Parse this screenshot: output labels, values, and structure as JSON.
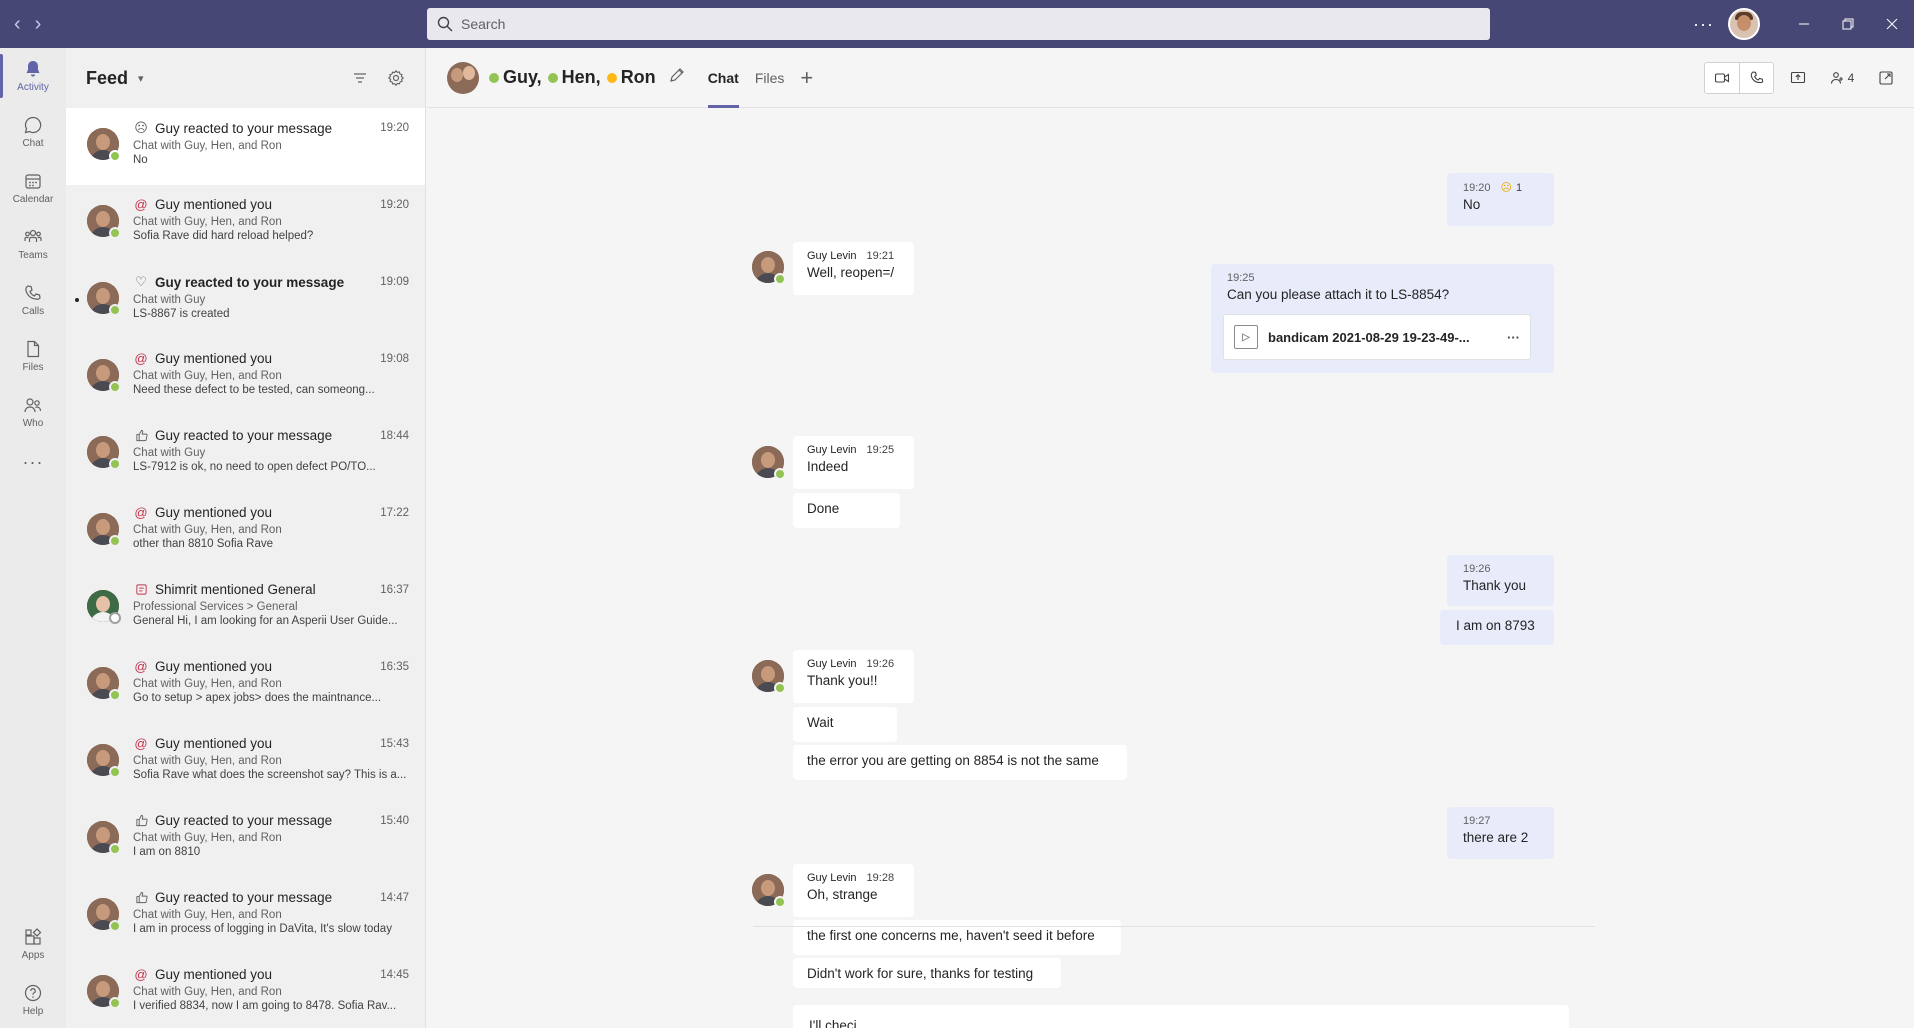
{
  "search": {
    "placeholder": "Search"
  },
  "titlebar": {
    "more": "···"
  },
  "rail": {
    "items": [
      {
        "label": "Activity",
        "icon": "bell-icon"
      },
      {
        "label": "Chat",
        "icon": "chat-icon"
      },
      {
        "label": "Calendar",
        "icon": "calendar-icon"
      },
      {
        "label": "Teams",
        "icon": "teams-icon"
      },
      {
        "label": "Calls",
        "icon": "phone-icon"
      },
      {
        "label": "Files",
        "icon": "file-icon"
      },
      {
        "label": "Who",
        "icon": "who-icon"
      }
    ],
    "more": "···",
    "bottom": [
      {
        "label": "Apps",
        "icon": "apps-icon"
      },
      {
        "label": "Help",
        "icon": "help-icon"
      }
    ]
  },
  "feed": {
    "title": "Feed",
    "items": [
      {
        "icon": "sad-emoji-icon",
        "title": "Guy reacted to your message",
        "time": "19:20",
        "sub": "Chat with Guy, Hen, and Ron",
        "preview": "No"
      },
      {
        "icon": "at-icon",
        "title": "Guy mentioned you",
        "time": "19:20",
        "sub": "Chat with Guy, Hen, and Ron",
        "preview": "Sofia Rave did hard reload helped?"
      },
      {
        "icon": "heart-icon",
        "title": "Guy reacted to your message",
        "time": "19:09",
        "sub": "Chat with Guy",
        "preview": "LS-8867 is created"
      },
      {
        "icon": "at-icon",
        "title": "Guy mentioned you",
        "time": "19:08",
        "sub": "Chat with Guy, Hen, and Ron",
        "preview": "Need these defect to be tested, can someong..."
      },
      {
        "icon": "like-icon",
        "title": "Guy reacted to your message",
        "time": "18:44",
        "sub": "Chat with Guy",
        "preview": "LS-7912 is ok, no need to open defect PO/TO..."
      },
      {
        "icon": "at-icon",
        "title": "Guy mentioned you",
        "time": "17:22",
        "sub": "Chat with Guy, Hen, and Ron",
        "preview": "other than 8810 Sofia Rave"
      },
      {
        "icon": "channel-icon",
        "title": "Shimrit mentioned General",
        "time": "16:37",
        "sub": "Professional Services > General",
        "preview": "General Hi, I am looking for an Asperii User Guide..."
      },
      {
        "icon": "at-icon",
        "title": "Guy mentioned you",
        "time": "16:35",
        "sub": "Chat with Guy, Hen, and Ron",
        "preview": "Go to setup > apex jobs> does the maintnance..."
      },
      {
        "icon": "at-icon",
        "title": "Guy mentioned you",
        "time": "15:43",
        "sub": "Chat with Guy, Hen, and Ron",
        "preview": "Sofia Rave what does the screenshot say? This is a..."
      },
      {
        "icon": "like-icon",
        "title": "Guy reacted to your message",
        "time": "15:40",
        "sub": "Chat with Guy, Hen, and Ron",
        "preview": "I am on 8810"
      },
      {
        "icon": "like-icon",
        "title": "Guy reacted to your message",
        "time": "14:47",
        "sub": "Chat with Guy, Hen, and Ron",
        "preview": "I am in process of logging in DaVita, It's slow today"
      },
      {
        "icon": "at-icon",
        "title": "Guy mentioned you",
        "time": "14:45",
        "sub": "Chat with Guy, Hen, and Ron",
        "preview": "I verified 8834, now I am going to 8478. Sofia Rav..."
      }
    ]
  },
  "chat": {
    "participants": [
      "Guy,",
      "Hen,",
      "Ron"
    ],
    "tabs": [
      "Chat",
      "Files"
    ],
    "tab_add": "+",
    "people_count": "4",
    "messages": {
      "m1": {
        "time": "19:20",
        "reaction_count": "1",
        "text": "No"
      },
      "m2": {
        "author": "Guy Levin",
        "time": "19:21",
        "text": "Well, reopen=/"
      },
      "m3": {
        "time": "19:25",
        "text": "Can you please attach it to LS-8854?",
        "attachment": "bandicam 2021-08-29 19-23-49-...",
        "attachment_more": "···"
      },
      "m4": {
        "author": "Guy Levin",
        "time": "19:25",
        "text": "Indeed"
      },
      "m4b": {
        "text": "Done"
      },
      "m5": {
        "time": "19:26",
        "text": "Thank you"
      },
      "m5b": {
        "text": "I am on 8793"
      },
      "m6": {
        "author": "Guy Levin",
        "time": "19:26",
        "text": "Thank you!!"
      },
      "m6b": {
        "text": "Wait"
      },
      "m6c": {
        "text": "the error you are getting on 8854 is not the same"
      },
      "m7": {
        "time": "19:27",
        "text": "there are 2"
      },
      "m8": {
        "author": "Guy Levin",
        "time": "19:28",
        "text": "Oh, strange"
      },
      "m8b": {
        "text": "the first one concerns me, haven't seed it before"
      },
      "m8c": {
        "text": "Didn't work for sure, thanks for testing"
      }
    },
    "compose": {
      "value": "I'll checj"
    },
    "toolbar_more": "···"
  },
  "colors": {
    "titlebar": "#464775",
    "accent": "#6264a7",
    "available": "#92c353",
    "away": "#fdb913",
    "mention": "#c4314b"
  }
}
